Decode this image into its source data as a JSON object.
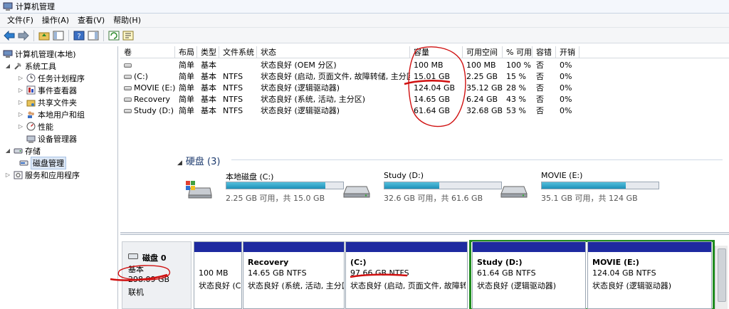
{
  "window": {
    "title": "计算机管理"
  },
  "menu": [
    "文件(F)",
    "操作(A)",
    "查看(V)",
    "帮助(H)"
  ],
  "tree": {
    "root": "计算机管理(本地)",
    "system_tools": "系统工具",
    "task_scheduler": "任务计划程序",
    "event_viewer": "事件查看器",
    "shared_folders": "共享文件夹",
    "local_users": "本地用户和组",
    "performance": "性能",
    "device_manager": "设备管理器",
    "storage": "存储",
    "disk_management": "磁盘管理",
    "services_apps": "服务和应用程序"
  },
  "volumes": {
    "headers": [
      "卷",
      "布局",
      "类型",
      "文件系统",
      "状态",
      "容量",
      "可用空间",
      "% 可用",
      "容错",
      "开销"
    ],
    "rows": [
      [
        "",
        "简单",
        "基本",
        "",
        "状态良好 (OEM 分区)",
        "100 MB",
        "100 MB",
        "100 %",
        "否",
        "0%"
      ],
      [
        "(C:)",
        "简单",
        "基本",
        "NTFS",
        "状态良好 (启动, 页面文件, 故障转储, 主分区)",
        "15.01 GB",
        "2.25 GB",
        "15 %",
        "否",
        "0%"
      ],
      [
        "MOVIE (E:)",
        "简单",
        "基本",
        "NTFS",
        "状态良好 (逻辑驱动器)",
        "124.04 GB",
        "35.12 GB",
        "28 %",
        "否",
        "0%"
      ],
      [
        "Recovery",
        "简单",
        "基本",
        "NTFS",
        "状态良好 (系统, 活动, 主分区)",
        "14.65 GB",
        "6.24 GB",
        "43 %",
        "否",
        "0%"
      ],
      [
        "Study (D:)",
        "简单",
        "基本",
        "NTFS",
        "状态良好 (逻辑驱动器)",
        "61.64 GB",
        "32.68 GB",
        "53 %",
        "否",
        "0%"
      ]
    ]
  },
  "drives": {
    "heading": "硬盘 (3)",
    "items": [
      {
        "name": "本地磁盘 (C:)",
        "info": "2.25 GB 可用，共 15.0 GB",
        "used_fraction": 0.85
      },
      {
        "name": "Study (D:)",
        "info": "32.6 GB 可用，共 61.6 GB",
        "used_fraction": 0.47
      },
      {
        "name": "MOVIE (E:)",
        "info": "35.1 GB 可用，共 124 GB",
        "used_fraction": 0.72
      }
    ]
  },
  "disk0": {
    "title": "磁盘 0",
    "type": "基本",
    "size": "298.09 GB",
    "status": "联机",
    "partitions": [
      {
        "name": "",
        "size": "100 MB",
        "status": "状态良好 (C"
      },
      {
        "name": "Recovery",
        "size": "14.65 GB NTFS",
        "status": "状态良好 (系统, 活动, 主分区)"
      },
      {
        "name": "(C:)",
        "size": "97.66 GB NTFS",
        "status": "状态良好 (启动, 页面文件, 故障转储"
      },
      {
        "name": "Study  (D:)",
        "size": "61.64 GB NTFS",
        "status": "状态良好 (逻辑驱动器)"
      },
      {
        "name": "MOVIE  (E:)",
        "size": "124.04 GB NTFS",
        "status": "状态良好 (逻辑驱动器)"
      }
    ]
  },
  "colors": {
    "partition_bar": "#1e2aa0",
    "logical_group": "#1e8c1e",
    "annotation": "#d01010"
  }
}
